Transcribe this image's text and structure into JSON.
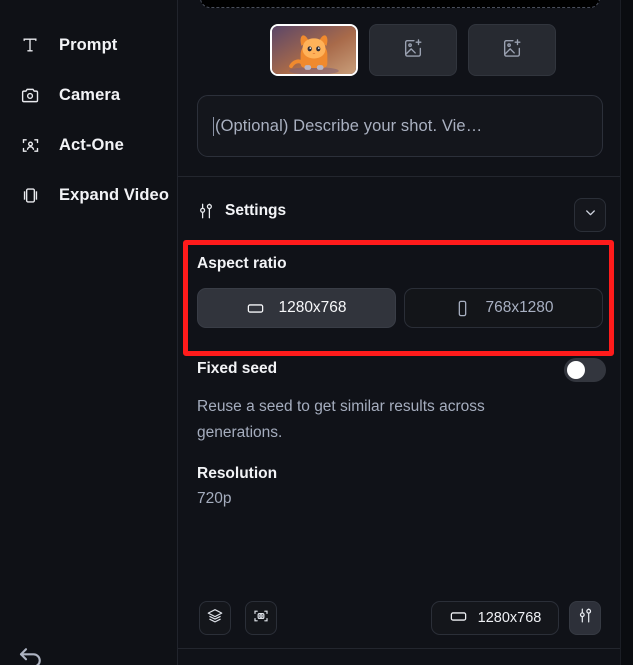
{
  "sidebar": {
    "items": [
      {
        "label": "Prompt",
        "icon": "text-t-icon"
      },
      {
        "label": "Camera",
        "icon": "camera-icon"
      },
      {
        "label": "Act-One",
        "icon": "person-frame-icon"
      },
      {
        "label": "Expand Video",
        "icon": "expand-frame-icon"
      }
    ],
    "undo_icon": "undo-icon"
  },
  "panel": {
    "thumbnails": [
      {
        "name": "reference-image-thumbnail",
        "selected": true,
        "icon": ""
      },
      {
        "name": "add-image-slot-1",
        "selected": false,
        "icon": "image-plus-icon"
      },
      {
        "name": "add-image-slot-2",
        "selected": false,
        "icon": "image-plus-icon"
      }
    ],
    "prompt": {
      "placeholder": "(Optional) Describe your shot. Vie…",
      "value": ""
    },
    "settings": {
      "title": "Settings",
      "icon": "tune-icon",
      "collapse_icon": "chevron-down-icon"
    },
    "aspect_ratio": {
      "label": "Aspect ratio",
      "options": [
        {
          "label": "1280x768",
          "icon": "landscape-icon",
          "selected": true
        },
        {
          "label": "768x1280",
          "icon": "portrait-icon",
          "selected": false
        }
      ]
    },
    "fixed_seed": {
      "label": "Fixed seed",
      "description": "Reuse a seed to get similar results across generations.",
      "enabled": false
    },
    "resolution": {
      "label": "Resolution",
      "value": "720p"
    },
    "bottom_bar": {
      "layers_icon": "layers-icon",
      "scan_icon": "scan-frame-icon",
      "size_label": "1280x768",
      "size_icon": "landscape-icon",
      "tune_icon": "tune-icon"
    }
  },
  "annotation": {
    "highlight_color": "#ff1b1b",
    "target": "Aspect ratio"
  }
}
